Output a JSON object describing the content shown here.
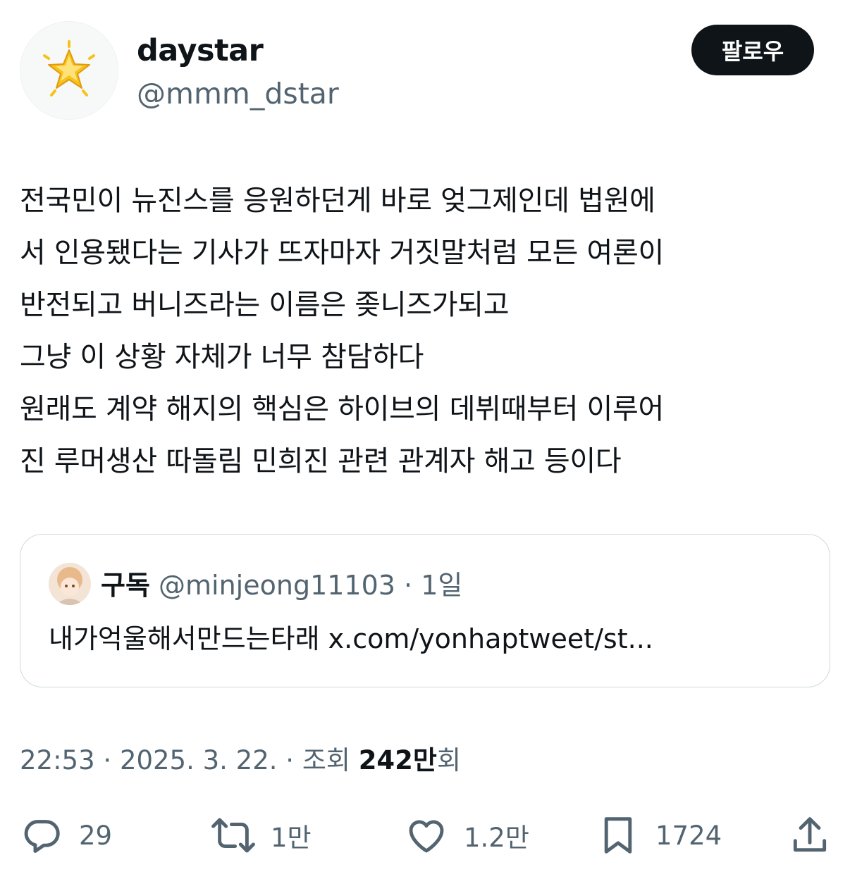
{
  "author": {
    "display_name": "daystar",
    "handle": "@mmm_dstar",
    "avatar_icon": "glowing-star-emoji"
  },
  "follow_button": {
    "label": "팔로우"
  },
  "tweet": {
    "lines": [
      "전국민이 뉴진스를 응원하던게 바로 엊그제인데 법원에",
      "서 인용됐다는 기사가 뜨자마자 거짓말처럼 모든 여론이",
      "반전되고 버니즈라는 이름은 좆니즈가되고",
      "그냥 이 상황 자체가 너무 참담하다",
      "원래도 계약 해지의 핵심은 하이브의 데뷔때부터 이루어",
      "진 루머생산 따돌림 민희진 관련 관계자 해고 등이다"
    ]
  },
  "quote": {
    "name": "구독",
    "handle": "@minjeong11103",
    "separator": " · ",
    "time": "1일",
    "text": "내가억울해서만드는타래 x.com/yonhaptweet/st..."
  },
  "meta": {
    "time": "22:53",
    "date": "2025. 3. 22.",
    "views_label": "조회",
    "views_count": "242만",
    "views_suffix": "회",
    "separator": " · "
  },
  "actions": {
    "reply": {
      "icon": "reply-icon",
      "count": "29"
    },
    "retweet": {
      "icon": "retweet-icon",
      "count": "1만"
    },
    "like": {
      "icon": "heart-icon",
      "count": "1.2만"
    },
    "bookmark": {
      "icon": "bookmark-icon",
      "count": "1724"
    },
    "share": {
      "icon": "share-icon"
    }
  },
  "colors": {
    "text_primary": "#0f1419",
    "text_secondary": "#536471",
    "border": "#cfd9de",
    "button_bg": "#0f1419",
    "star": "#f7c21a"
  }
}
